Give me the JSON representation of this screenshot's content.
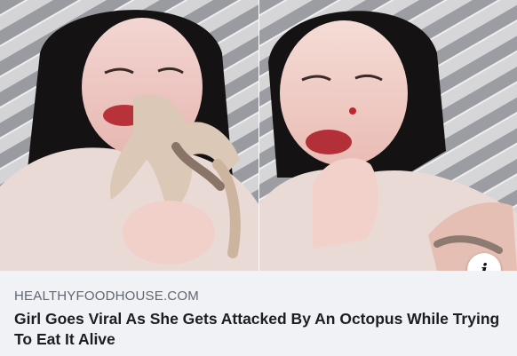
{
  "link_preview": {
    "domain": "HEALTHYFOODHOUSE.COM",
    "headline": "Girl Goes Viral As She Gets Attacked By An Octopus While Trying To Eat It Alive",
    "info_icon": "info-icon",
    "info_glyph": "i"
  },
  "photos": [
    {
      "name": "left-photo"
    },
    {
      "name": "right-photo"
    }
  ],
  "colors": {
    "background": "#f0f2f5",
    "domain_text": "#606770",
    "headline_text": "#1c1e21"
  }
}
